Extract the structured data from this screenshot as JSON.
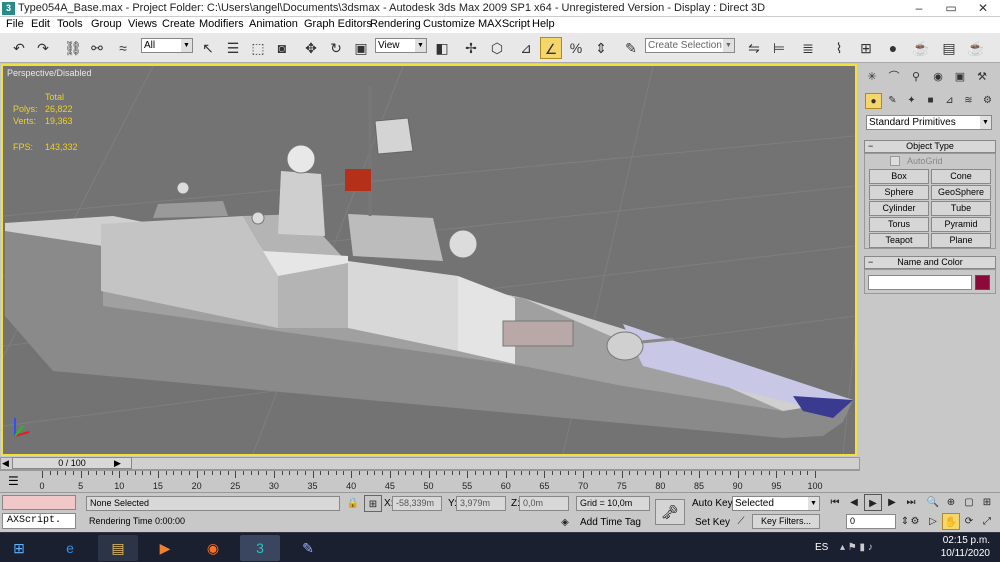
{
  "window": {
    "title": "Type054A_Base.max   - Project Folder: C:\\Users\\angel\\Documents\\3dsmax   - Autodesk 3ds Max  2009 SP1  x64   - Unregistered Version   - Display : Direct 3D"
  },
  "menu": [
    "File",
    "Edit",
    "Tools",
    "Group",
    "Views",
    "Create",
    "Modifiers",
    "Animation",
    "Graph Editors",
    "Rendering",
    "Customize",
    "MAXScript",
    "Help"
  ],
  "toolbar": {
    "filter_value": "All",
    "refcoord_value": "View",
    "named_selection_placeholder": "Create Selection Set"
  },
  "viewport": {
    "label": "Perspective/Disabled",
    "stats": {
      "total_label": "Total",
      "polys_label": "Polys:",
      "polys_value": "26,822",
      "verts_label": "Verts:",
      "verts_value": "19,363",
      "fps_label": "FPS:",
      "fps_value": "143,332"
    }
  },
  "command_panel": {
    "category_value": "Standard Primitives",
    "object_type_title": "Object Type",
    "autogrid_label": "AutoGrid",
    "primitives": [
      "Box",
      "Cone",
      "Sphere",
      "GeoSphere",
      "Cylinder",
      "Tube",
      "Torus",
      "Pyramid",
      "Teapot",
      "Plane"
    ],
    "name_color_title": "Name and Color",
    "object_color": "#8b0a3a"
  },
  "timeline": {
    "slider_label": "0 / 100",
    "ticks": [
      "0",
      "5",
      "10",
      "15",
      "20",
      "25",
      "30",
      "35",
      "40",
      "45",
      "50",
      "55",
      "60",
      "65",
      "70",
      "75",
      "80",
      "85",
      "90",
      "95",
      "100"
    ]
  },
  "status": {
    "maxscript_label": "AXScript.",
    "selection_text": "None Selected",
    "render_time_text": "Rendering Time  0:00:00",
    "x_label": "X:",
    "x_value": "-58,339m",
    "y_label": "Y:",
    "y_value": "3,979m",
    "z_label": "Z:",
    "z_value": "0,0m",
    "grid_text": "Grid = 10,0m",
    "add_time_tag": "Add Time Tag",
    "auto_key": "Auto Key",
    "set_key": "Set Key",
    "selected_value": "Selected",
    "key_filters": "Key Filters...",
    "frame_value": "0"
  },
  "taskbar": {
    "lang": "ES",
    "time": "02:15 p.m.",
    "date": "10/11/2020"
  }
}
